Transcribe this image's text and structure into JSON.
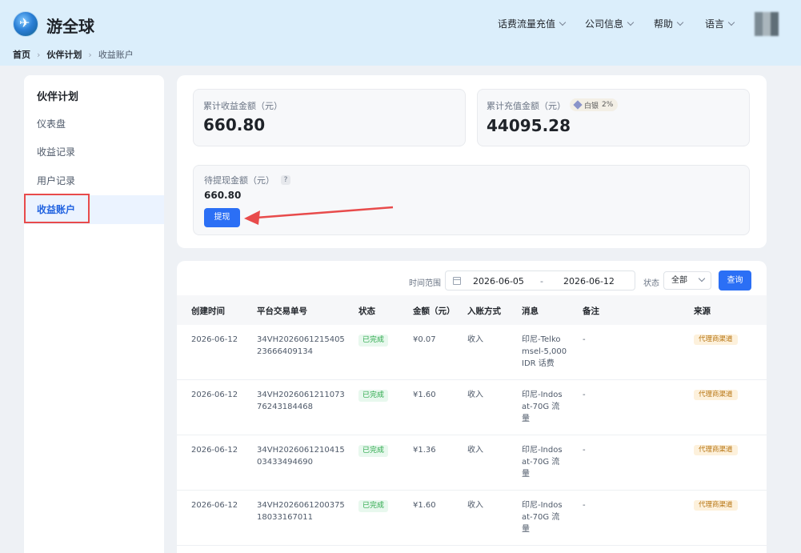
{
  "header": {
    "brand": "游全球",
    "nav": [
      {
        "label": "话费流量充值"
      },
      {
        "label": "公司信息"
      },
      {
        "label": "帮助"
      },
      {
        "label": "语言"
      }
    ]
  },
  "breadcrumb": [
    "首页",
    "伙伴计划",
    "收益账户"
  ],
  "sidebar": {
    "title": "伙伴计划",
    "items": [
      {
        "label": "仪表盘"
      },
      {
        "label": "收益记录"
      },
      {
        "label": "用户记录"
      },
      {
        "label": "收益账户"
      }
    ],
    "active": "收益账户"
  },
  "summary": {
    "total_income_label": "累计收益金额（元）",
    "total_income_value": "660.80",
    "total_recharge_label": "累计充值金额（元）",
    "total_recharge_value": "44095.28",
    "level_badge": "白银",
    "level_rate": "2%",
    "pending_label": "待提现金额（元）",
    "pending_help": "?",
    "pending_value": "660.80",
    "withdraw_button": "提现"
  },
  "filters": {
    "time_label": "时间范围",
    "start_date": "2026-06-05",
    "separator": "-",
    "end_date": "2026-06-12",
    "status_label": "状态",
    "status_value": "全部",
    "query_button": "查询"
  },
  "table": {
    "columns": [
      "创建时间",
      "平台交易单号",
      "状态",
      "金额（元）",
      "入账方式",
      "消息",
      "备注",
      "来源"
    ],
    "rows": [
      {
        "created": "2026-06-12",
        "order_line1": "34VH2026061215405",
        "order_line2": "23666409134",
        "status": "已完成",
        "amount": "¥0.07",
        "method": "收入",
        "msg_line1": "印尼-Telko",
        "msg_line2": "msel-5,000",
        "msg_line3": "IDR 话费",
        "note": "-",
        "source": "代理商渠道"
      },
      {
        "created": "2026-06-12",
        "order_line1": "34VH2026061211073",
        "order_line2": "76243184468",
        "status": "已完成",
        "amount": "¥1.60",
        "method": "收入",
        "msg_line1": "印尼-Indos",
        "msg_line2": "at-70G 流",
        "msg_line3": "量",
        "note": "-",
        "source": "代理商渠道"
      },
      {
        "created": "2026-06-12",
        "order_line1": "34VH2026061210415",
        "order_line2": "03433494690",
        "status": "已完成",
        "amount": "¥1.36",
        "method": "收入",
        "msg_line1": "印尼-Indos",
        "msg_line2": "at-70G 流",
        "msg_line3": "量",
        "note": "-",
        "source": "代理商渠道"
      },
      {
        "created": "2026-06-12",
        "order_line1": "34VH2026061200375",
        "order_line2": "18033167011",
        "status": "已完成",
        "amount": "¥1.60",
        "method": "收入",
        "msg_line1": "印尼-Indos",
        "msg_line2": "at-70G 流",
        "msg_line3": "量",
        "note": "-",
        "source": "代理商渠道"
      }
    ]
  },
  "colors": {
    "primary": "#2b6ff5",
    "annotation_red": "#e84b4b",
    "header_bg": "#dbeefb"
  }
}
